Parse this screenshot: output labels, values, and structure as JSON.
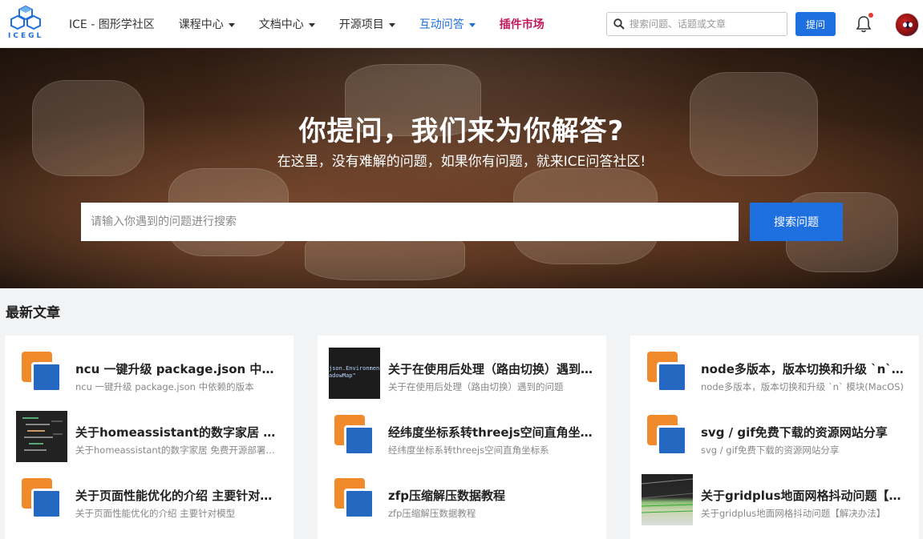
{
  "header": {
    "logo_text": "ICEGL",
    "nav": [
      {
        "label": "ICE - 图形学社区",
        "dropdown": false
      },
      {
        "label": "课程中心",
        "dropdown": true
      },
      {
        "label": "文档中心",
        "dropdown": true
      },
      {
        "label": "开源项目",
        "dropdown": true
      },
      {
        "label": "互动问答",
        "dropdown": true,
        "active": true
      },
      {
        "label": "插件市场",
        "dropdown": false
      }
    ],
    "search_placeholder": "搜索问题、话题或文章",
    "ask_button": "提问",
    "notification_unread": true
  },
  "hero": {
    "title": "你提问，我们来为你解答?",
    "subtitle": "在这里，没有难解的问题，如果你有问题，就来ICE问答社区!",
    "search_placeholder": "请输入你遇到的问题进行搜索",
    "search_button": "搜索问题"
  },
  "articles": {
    "section_title": "最新文章",
    "columns": [
      [
        {
          "title": "ncu 一键升级 package.json 中依赖的版本",
          "desc": "ncu 一键升级 package.json 中依赖的版本",
          "thumb": "doc-icon"
        },
        {
          "title": "关于homeassistant的数字家居 免费开源部署方案",
          "desc": "关于homeassistant的数字家居 免费开源部署方案",
          "thumb": "editor-screenshot"
        },
        {
          "title": "关于页面性能优化的介绍 主要针对模型",
          "desc": "关于页面性能优化的介绍 主要针对模型",
          "thumb": "doc-icon"
        }
      ],
      [
        {
          "title": "关于在使用后处理（路由切换）遇到的问题",
          "desc": "关于在使用后处理（路由切换）遇到的问题",
          "thumb": "code-screenshot",
          "thumb_text": [
            "json.Environment",
            "adowMap\""
          ]
        },
        {
          "title": "经纬度坐标系转threejs空间直角坐标系",
          "desc": "经纬度坐标系转threejs空间直角坐标系",
          "thumb": "doc-icon"
        },
        {
          "title": "zfp压缩解压数据教程",
          "desc": "zfp压缩解压数据教程",
          "thumb": "doc-icon"
        }
      ],
      [
        {
          "title": "node多版本，版本切换和升级 `n` 模块(MacOS)",
          "desc": "node多版本，版本切换和升级 `n` 模块(MacOS)",
          "thumb": "doc-icon"
        },
        {
          "title": "svg / gif免费下载的资源网站分享",
          "desc": "svg / gif免费下载的资源网站分享",
          "thumb": "doc-icon"
        },
        {
          "title": "关于gridplus地面网格抖动问题【解决办法】",
          "desc": "关于gridplus地面网格抖动问题【解决办法】",
          "thumb": "grid-screenshot"
        }
      ]
    ]
  },
  "colors": {
    "primary": "#1e6fe0",
    "plugin": "#c2185b",
    "doc_orange": "#f08a2b",
    "doc_blue": "#2468c2"
  }
}
